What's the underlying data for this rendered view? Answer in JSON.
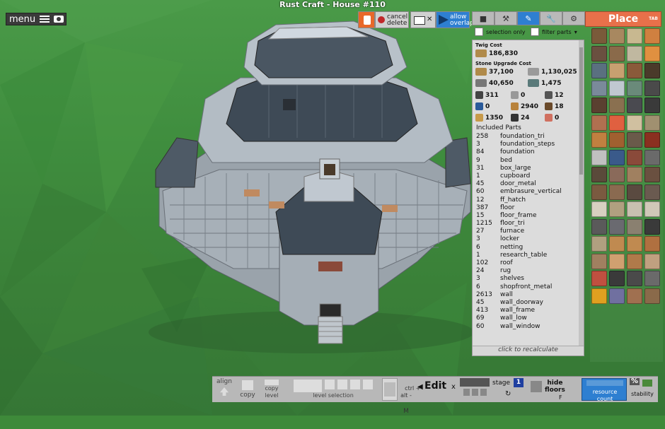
{
  "window": {
    "title": "Rust Craft - House #110"
  },
  "menu": {
    "label": "menu"
  },
  "top_buttons": {
    "cancel_delete": "cancel\ndelete",
    "allow_overlap": "allow\noverlap"
  },
  "tool_tabs": [
    "cube-icon",
    "hammer-icon",
    "pencil-icon",
    "wrench-icon",
    "spanner-icon"
  ],
  "filters": {
    "selection_only": "selection only",
    "filter_parts": "filter parts"
  },
  "cost_panel": {
    "twig_header": "Twig Cost",
    "twig_amount": "186,830",
    "stone_header": "Stone Upgrade Cost",
    "stone": [
      {
        "icon": "wood",
        "value": "37,100",
        "color": "#b08a4a"
      },
      {
        "icon": "stone",
        "value": "1,130,025",
        "color": "#9a9a9a"
      },
      {
        "icon": "metal-fragments",
        "value": "40,650",
        "color": "#777"
      },
      {
        "icon": "hqm",
        "value": "1,475",
        "color": "#5a7a7a"
      },
      {
        "icon": "gear",
        "value": "311",
        "color": "#444"
      },
      {
        "icon": "tarp",
        "value": "0",
        "color": "#999"
      },
      {
        "icon": "pipe",
        "value": "12",
        "color": "#555"
      },
      {
        "icon": "blue-print",
        "value": "0",
        "color": "#2a5a9a"
      },
      {
        "icon": "rope",
        "value": "2940",
        "color": "#b8823a"
      },
      {
        "icon": "spring",
        "value": "18",
        "color": "#6a4a2a"
      },
      {
        "icon": "cloth",
        "value": "1350",
        "color": "#c79a4a"
      },
      {
        "icon": "sewing",
        "value": "24",
        "color": "#333"
      },
      {
        "icon": "leather",
        "value": "0",
        "color": "#d07060"
      }
    ],
    "included_parts_label": "Included Parts",
    "parts": [
      {
        "q": "258",
        "name": "foundation_tri"
      },
      {
        "q": "3",
        "name": "foundation_steps"
      },
      {
        "q": "84",
        "name": "foundation"
      },
      {
        "q": "9",
        "name": "bed"
      },
      {
        "q": "31",
        "name": "box_large"
      },
      {
        "q": "1",
        "name": "cupboard"
      },
      {
        "q": "45",
        "name": "door_metal"
      },
      {
        "q": "60",
        "name": "embrasure_vertical"
      },
      {
        "q": "12",
        "name": "ff_hatch"
      },
      {
        "q": "387",
        "name": "floor"
      },
      {
        "q": "15",
        "name": "floor_frame"
      },
      {
        "q": "1215",
        "name": "floor_tri"
      },
      {
        "q": "27",
        "name": "furnace"
      },
      {
        "q": "3",
        "name": "locker"
      },
      {
        "q": "6",
        "name": "netting"
      },
      {
        "q": "1",
        "name": "research_table"
      },
      {
        "q": "102",
        "name": "roof"
      },
      {
        "q": "24",
        "name": "rug"
      },
      {
        "q": "3",
        "name": "shelves"
      },
      {
        "q": "6",
        "name": "shopfront_metal"
      },
      {
        "q": "2613",
        "name": "wall"
      },
      {
        "q": "45",
        "name": "wall_doorway"
      },
      {
        "q": "413",
        "name": "wall_frame"
      },
      {
        "q": "69",
        "name": "wall_low"
      },
      {
        "q": "60",
        "name": "wall_window"
      }
    ],
    "recalc_label": "click to recalculate"
  },
  "place_panel": {
    "title": "Place",
    "tab_hint": "TAB",
    "items": [
      "#7a5a3a",
      "#a88860",
      "#c8b890",
      "#d08040",
      "#6a5040",
      "#8a6a4a",
      "#c0b8a0",
      "#e09040",
      "#5a7080",
      "#c8a070",
      "#8a5a3a",
      "#4a3a2a",
      "#7a8a9a",
      "#c0c8d0",
      "#6a8a7a",
      "#4a4a4a",
      "#5a4030",
      "#8a7050",
      "#4a4a50",
      "#3a3a3a",
      "#b07050",
      "#e06040",
      "#d0c0a0",
      "#a09070",
      "#c08040",
      "#a06030",
      "#6a5a4a",
      "#8a3020",
      "#c0c0c0",
      "#3a5a8a",
      "#8a4a3a",
      "#6a6a6a",
      "#5a4a3a",
      "#8a6a5a",
      "#a08060",
      "#6a5040",
      "#7a5a40",
      "#8a6a50",
      "#5a4a40",
      "#6a5a50",
      "#d8d0c0",
      "#b0a080",
      "#c8c0b0",
      "#d0c8b8",
      "#5a5a5a",
      "#6a6a70",
      "#8a8070",
      "#3a3a3a",
      "#b0a080",
      "#c08a50",
      "#c08a50",
      "#b07040",
      "#a08060",
      "#d0a070",
      "#b07a4a",
      "#c0a080",
      "#c05040",
      "#3a3a3a",
      "#4a4a4a",
      "#6a6a6a",
      "#e0a020",
      "#7070a0",
      "#a07050",
      "#8a6a4a"
    ]
  },
  "bottom_bar": {
    "align": "align",
    "copy": "copy",
    "copy_level": "copy\nlevel",
    "level_selection": "level selection",
    "ctrl_alt": "ctrl +\nalt -",
    "m_key": "M",
    "edit": "Edit",
    "x": "x",
    "stage_label": "stage",
    "stage_value": "1",
    "hide_floors": "hide\nfloors",
    "f_key": "F",
    "resource_count": "resource\ncount",
    "stability": "stability",
    "percent": "%"
  }
}
